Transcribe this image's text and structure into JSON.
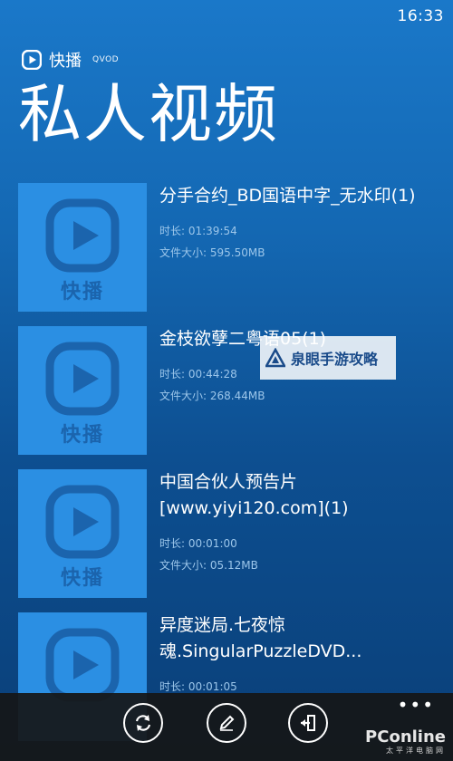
{
  "status": {
    "time": "16:33"
  },
  "app": {
    "name": "快播",
    "sub": "QVOD"
  },
  "page": {
    "title": "私人视频"
  },
  "thumb_label": "快播",
  "items": [
    {
      "title": "分手合约_BD国语中字_无水印(1)",
      "duration": "时长: 01:39:54",
      "size": "文件大小:  595.50MB"
    },
    {
      "title": "金枝欲孽二粤语05(1)",
      "duration": "时长: 00:44:28",
      "size": "文件大小:  268.44MB"
    },
    {
      "title": "中国合伙人预告片[www.yiyi120.com](1)",
      "duration": "时长: 00:01:00",
      "size": "文件大小:  05.12MB"
    },
    {
      "title": "异度迷局.七夜惊魂.SingularPuzzleDVD...",
      "duration": "时长: 00:01:05",
      "size": ""
    }
  ],
  "watermark": {
    "text": "泉眼手游攻略"
  },
  "appbar": {
    "more": "•••"
  },
  "footer": {
    "brand": "PConline",
    "sub": "太平洋电脑网"
  },
  "colors": {
    "bg": "#1468b3",
    "thumb": "#2b8fe3",
    "appbar": "#161616"
  }
}
